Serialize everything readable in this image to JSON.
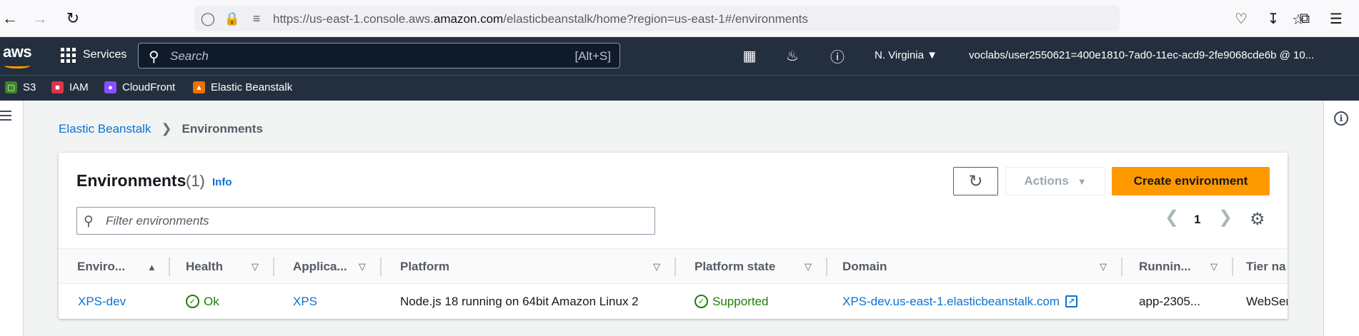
{
  "browser": {
    "url_prefix": "https://us-east-1.console.aws.",
    "url_domain": "amazon.com",
    "url_suffix": "/elasticbeanstalk/home?region=us-east-1#/environments"
  },
  "aws_nav": {
    "logo": "aws",
    "services_label": "Services",
    "search_placeholder": "Search",
    "search_shortcut": "[Alt+S]",
    "region": "N. Virginia",
    "account": "voclabs/user2550621=400e1810-7ad0-11ec-acd9-2fe9068cde6b @ 10..."
  },
  "favorites": [
    {
      "label": "S3",
      "color": "#3f8624"
    },
    {
      "label": "IAM",
      "color": "#dd344c"
    },
    {
      "label": "CloudFront",
      "color": "#8c4fff"
    },
    {
      "label": "Elastic Beanstalk",
      "color": "#ed7100"
    }
  ],
  "breadcrumb": {
    "parent": "Elastic Beanstalk",
    "current": "Environments"
  },
  "panel": {
    "title": "Environments",
    "count": "(1)",
    "info": "Info",
    "actions_label": "Actions",
    "create_label": "Create environment",
    "filter_placeholder": "Filter environments",
    "page_number": "1"
  },
  "table": {
    "headers": [
      "Enviro...",
      "Health",
      "Applica...",
      "Platform",
      "Platform state",
      "Domain",
      "Runnin...",
      "Tier na"
    ],
    "row": {
      "environment": "XPS-dev",
      "health": "Ok",
      "application": "XPS",
      "platform": "Node.js 18 running on 64bit Amazon Linux 2",
      "platform_state": "Supported",
      "domain": "XPS-dev.us-east-1.elasticbeanstalk.com",
      "running_version": "app-2305...",
      "tier": "WebSer"
    }
  },
  "colors": {
    "aws_nav_bg": "#232f3e",
    "link": "#0972d3",
    "primary_button": "#ff9900",
    "success": "#1d8102"
  }
}
